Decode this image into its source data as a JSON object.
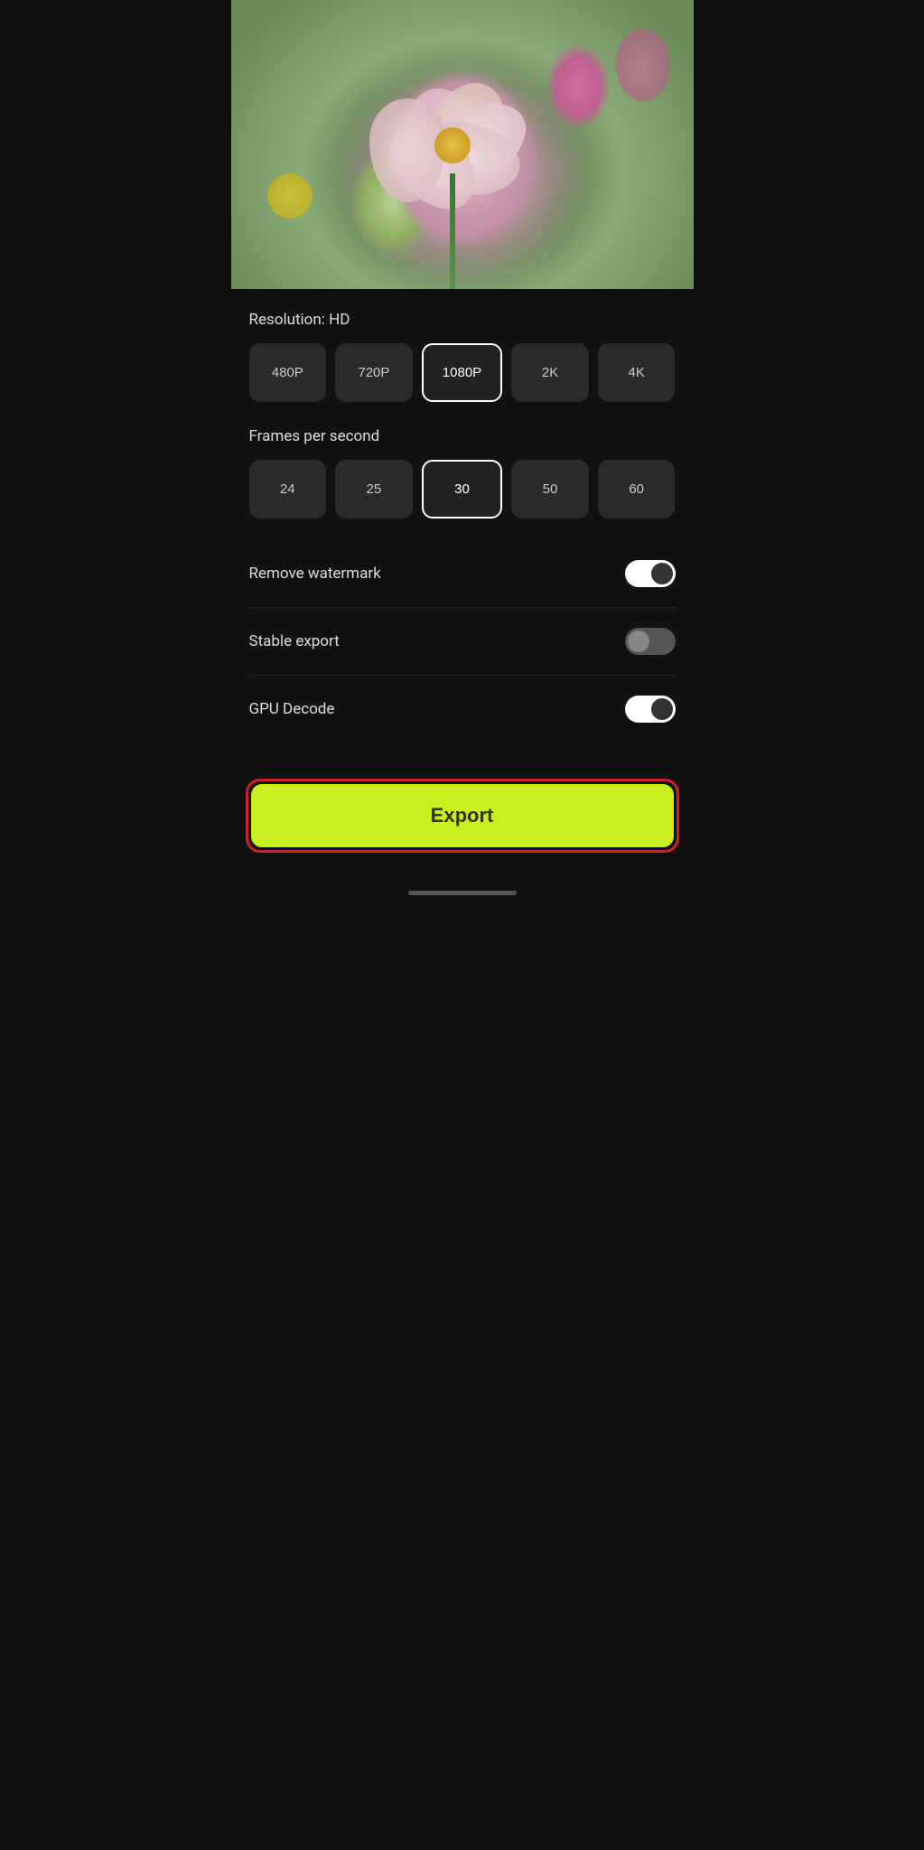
{
  "video": {
    "play_label": "▶"
  },
  "resolution": {
    "label": "Resolution: HD",
    "options": [
      "480P",
      "720P",
      "1080P",
      "2K",
      "4K"
    ],
    "selected_index": 2
  },
  "fps": {
    "label": "Frames per second",
    "options": [
      "24",
      "25",
      "30",
      "50",
      "60"
    ],
    "selected_index": 2
  },
  "toggles": [
    {
      "id": "remove-watermark",
      "label": "Remove watermark",
      "state": "on"
    },
    {
      "id": "stable-export",
      "label": "Stable export",
      "state": "off"
    },
    {
      "id": "gpu-decode",
      "label": "GPU Decode",
      "state": "on"
    }
  ],
  "export_button": {
    "label": "Export"
  }
}
